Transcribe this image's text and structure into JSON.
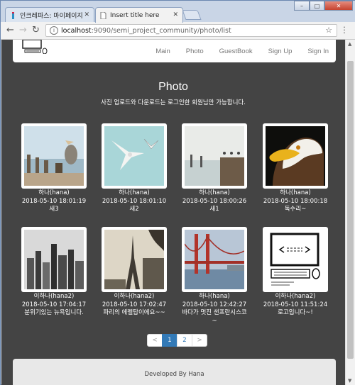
{
  "browser": {
    "tabs": [
      {
        "label": "인크레파스: 마이페이지"
      },
      {
        "label": "Insert title here"
      }
    ],
    "url_host": "localhost",
    "url_path": ":9090/semi_project_community/photo/list",
    "minimize": "–",
    "maximize": "□",
    "close": "✕"
  },
  "nav": {
    "items": [
      "Main",
      "Photo",
      "GuestBook",
      "Sign Up",
      "Sign In"
    ]
  },
  "page": {
    "title": "Photo",
    "subtitle": "사진 업로드와 다운로드는 로그인한 회원님만 가능합니다."
  },
  "photos": [
    {
      "author": "하나(hana)",
      "date": "2018-05-10 18:01:19",
      "caption": "새3",
      "image": "pelicans"
    },
    {
      "author": "하나(hana)",
      "date": "2018-05-10 18:01:10",
      "caption": "새2",
      "image": "seagulls"
    },
    {
      "author": "하나(hana)",
      "date": "2018-05-10 18:00:26",
      "caption": "새1",
      "image": "pier-birds"
    },
    {
      "author": "하나(hana)",
      "date": "2018-05-10 18:00:18",
      "caption": "독수리~",
      "image": "eagle"
    },
    {
      "author": "이하나(hana2)",
      "date": "2018-05-10 17:04:17",
      "caption": "분위기있는 뉴욕입니다.",
      "image": "new-york"
    },
    {
      "author": "이하나(hana2)",
      "date": "2018-05-10 17:02:47",
      "caption": "파리의 에펠탑이에요~~",
      "image": "eiffel-tower"
    },
    {
      "author": "하나(hana)",
      "date": "2018-05-10 12:42:27",
      "caption": "바다가 멋진 샌프란시스코~",
      "image": "golden-gate"
    },
    {
      "author": "이하나(hana2)",
      "date": "2018-05-10 11:51:24",
      "caption": "로고입니다~!",
      "image": "computer-logo"
    }
  ],
  "pager": {
    "prev": "<",
    "pages": [
      "1",
      "2"
    ],
    "next": ">"
  },
  "footer": {
    "text": "Developed By Hana"
  }
}
